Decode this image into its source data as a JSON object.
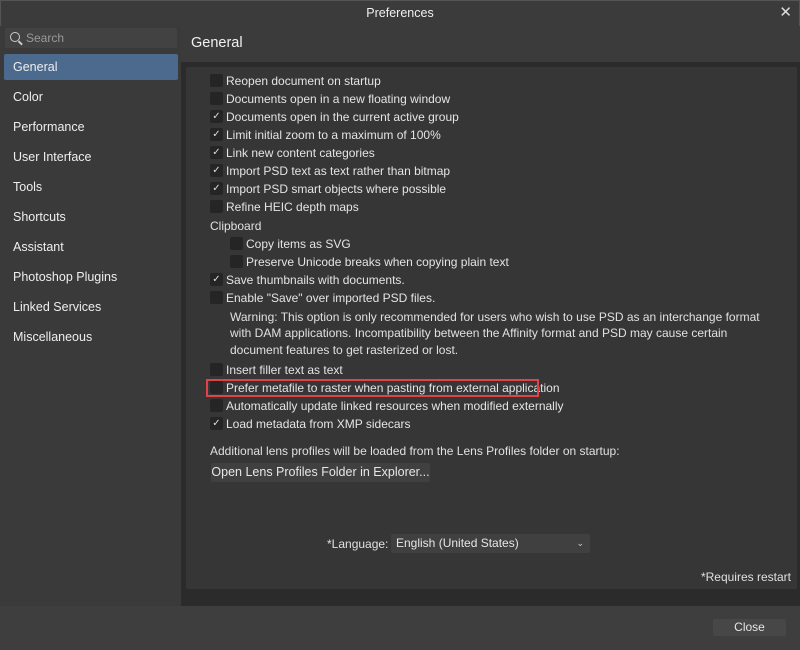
{
  "window": {
    "title": "Preferences",
    "close_glyph": "✕"
  },
  "sidebar": {
    "search_placeholder": "Search",
    "items": [
      {
        "label": "General",
        "selected": true
      },
      {
        "label": "Color"
      },
      {
        "label": "Performance"
      },
      {
        "label": "User Interface"
      },
      {
        "label": "Tools"
      },
      {
        "label": "Shortcuts"
      },
      {
        "label": "Assistant"
      },
      {
        "label": "Photoshop Plugins"
      },
      {
        "label": "Linked Services"
      },
      {
        "label": "Miscellaneous"
      }
    ]
  },
  "main": {
    "title": "General",
    "options": [
      {
        "label": "Reopen document on startup",
        "checked": false
      },
      {
        "label": "Documents open in a new floating window",
        "checked": false
      },
      {
        "label": "Documents open in the current active group",
        "checked": true
      },
      {
        "label": "Limit initial zoom to a maximum of 100%",
        "checked": true
      },
      {
        "label": "Link new content categories",
        "checked": true
      },
      {
        "label": "Import PSD text as text rather than bitmap",
        "checked": true
      },
      {
        "label": "Import PSD smart objects where possible",
        "checked": true
      },
      {
        "label": "Refine HEIC depth maps",
        "checked": false
      }
    ],
    "clipboard_label": "Clipboard",
    "clipboard_options": [
      {
        "label": "Copy items as SVG",
        "checked": false
      },
      {
        "label": "Preserve Unicode breaks when copying plain text",
        "checked": false
      }
    ],
    "options2": [
      {
        "label": "Save thumbnails with documents.",
        "checked": true
      },
      {
        "label": "Enable \"Save\" over imported PSD files.",
        "checked": false
      }
    ],
    "warning": [
      "Warning: This option is only recommended for users who wish to use PSD as an interchange format",
      "with DAM applications. Incompatibility between the Affinity format and PSD may cause certain",
      "document features to get rasterized or lost."
    ],
    "options3": [
      {
        "label": "Insert filler text as text",
        "checked": false
      },
      {
        "label": "Prefer metafile to raster when pasting from external application",
        "checked": false,
        "highlighted": true
      },
      {
        "label": "Automatically update linked resources when modified externally",
        "checked": false
      },
      {
        "label": "Load metadata from XMP sidecars",
        "checked": true
      }
    ],
    "lens_note": "Additional lens profiles will be loaded from the Lens Profiles folder on startup:",
    "lens_button": "Open Lens Profiles Folder in Explorer...",
    "language_label": "*Language:",
    "language_value": "English (United States)",
    "restart_note": "*Requires restart"
  },
  "footer": {
    "close_label": "Close"
  },
  "colors": {
    "accent": "#4c6a8e",
    "highlight": "#e0424a"
  }
}
